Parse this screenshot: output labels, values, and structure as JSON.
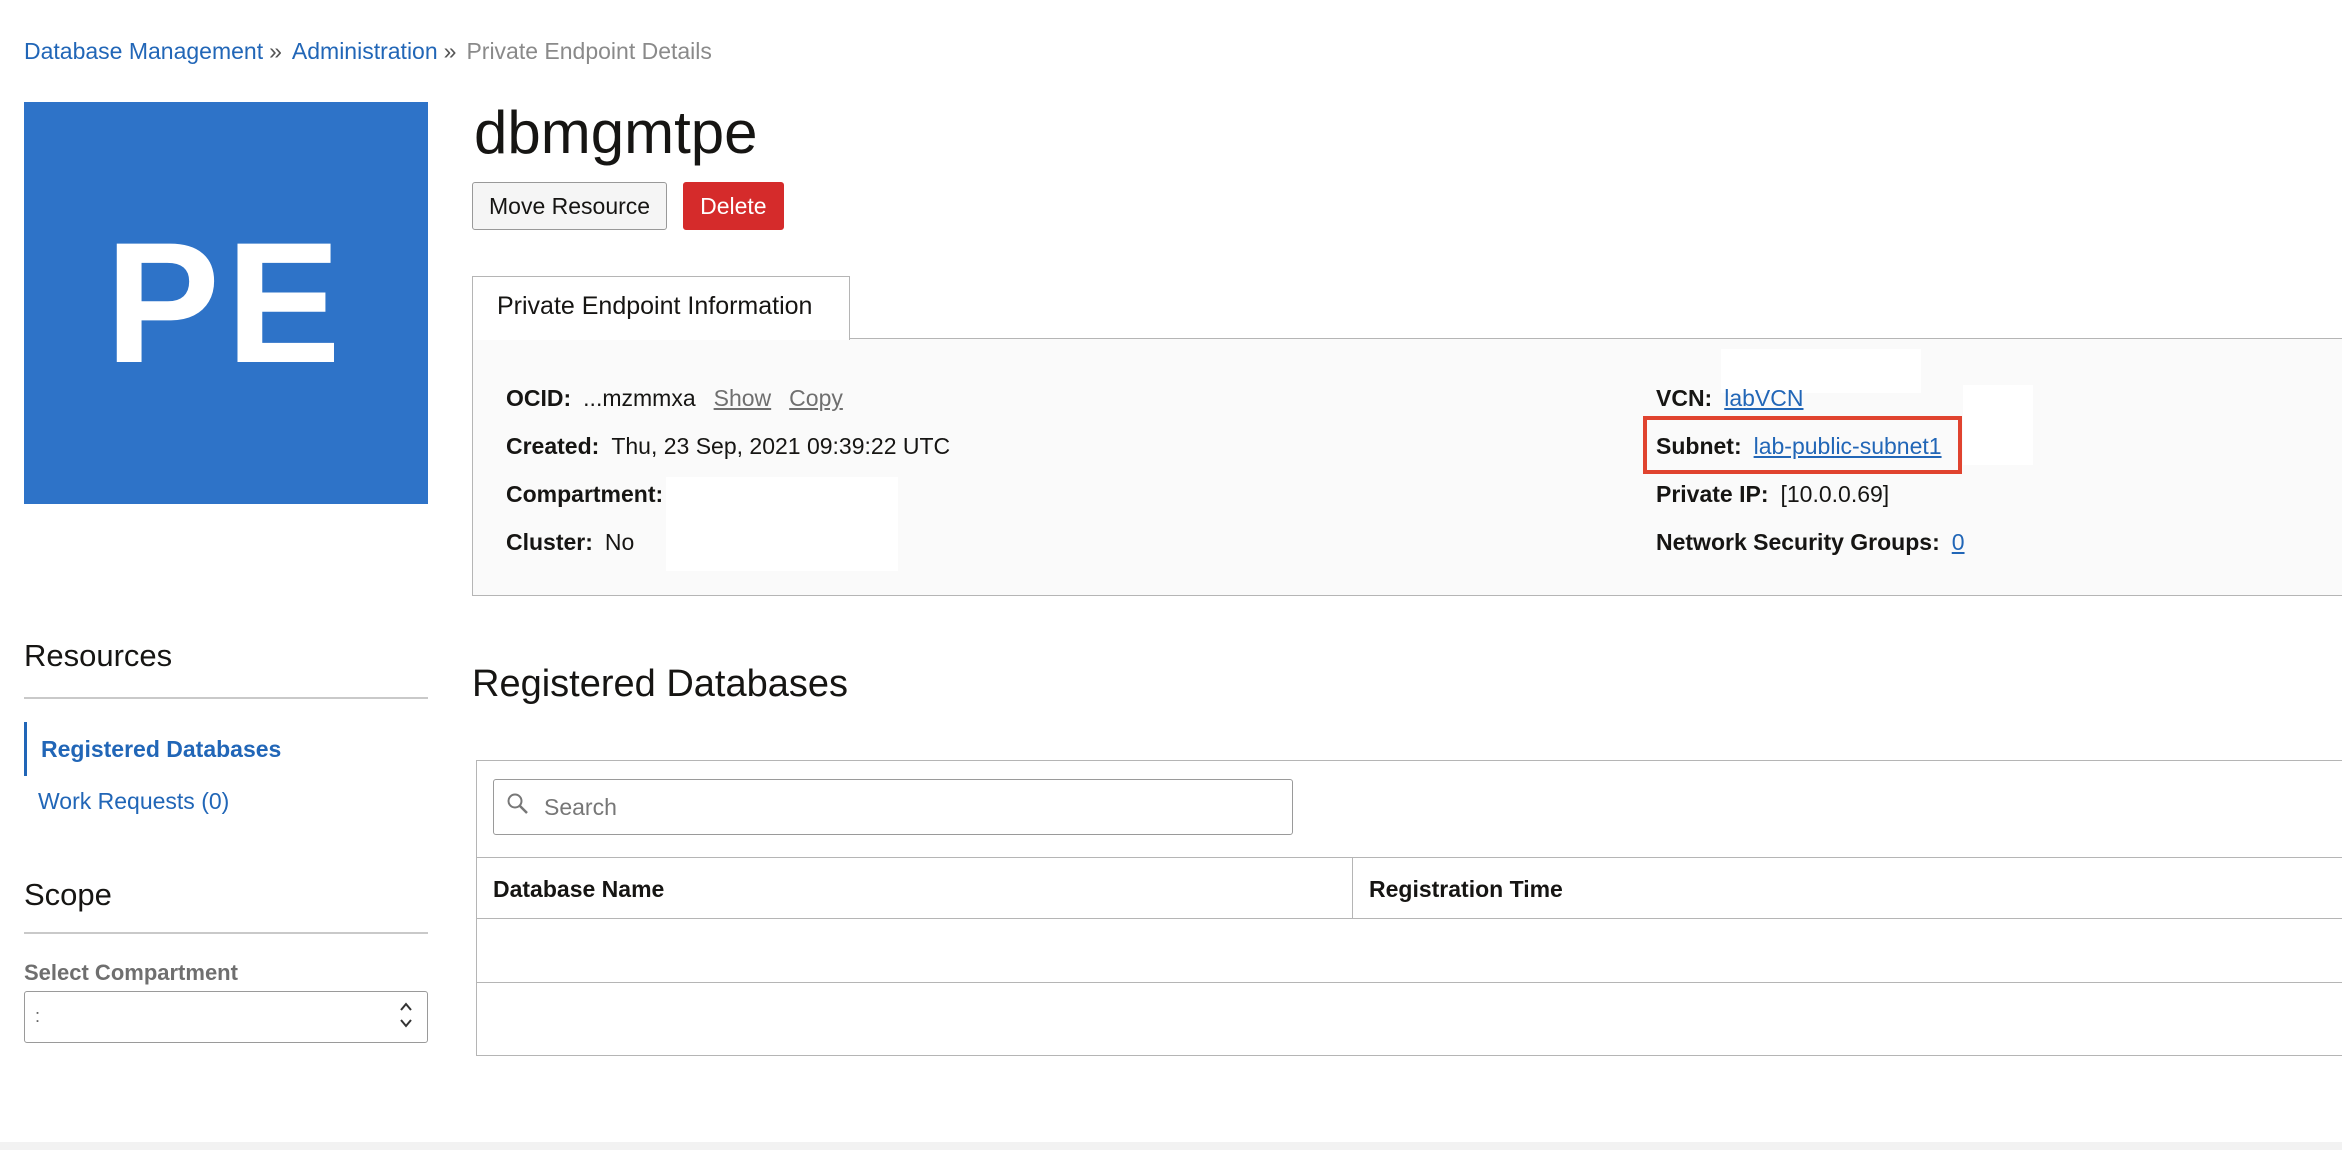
{
  "breadcrumb": [
    {
      "label": "Database Management",
      "separator": "»"
    },
    {
      "label": "Administration",
      "separator": "»"
    },
    {
      "label": "Private Endpoint Details"
    }
  ],
  "badge": {
    "text": "PE",
    "color": "#2e73c8"
  },
  "page": {
    "title": "dbmgmtpe"
  },
  "actions": {
    "move_label": "Move Resource",
    "delete_label": "Delete"
  },
  "info_tab": {
    "label": "Private Endpoint Information"
  },
  "info": {
    "ocid_label": "OCID:",
    "ocid_value": "...mzmmxa",
    "show_label": "Show",
    "copy_label": "Copy",
    "created_label": "Created:",
    "created_value": "Thu, 23 Sep, 2021 09:39:22 UTC",
    "compartment_label": "Compartment:",
    "cluster_label": "Cluster:",
    "cluster_value": "No",
    "vcn_label": "VCN:",
    "vcn_value": "labVCN",
    "subnet_label": "Subnet:",
    "subnet_value": "lab-public-subnet1",
    "private_ip_label": "Private IP:",
    "private_ip_value": "[10.0.0.69]",
    "nsg_label": "Network Security Groups:",
    "nsg_value": "0"
  },
  "sidebar": {
    "resources_title": "Resources",
    "items": [
      {
        "label": "Registered Databases",
        "active": true
      },
      {
        "label": "Work Requests (0)",
        "active": false
      }
    ],
    "scope_title": "Scope",
    "compartment_label": "Select Compartment",
    "compartment_value": ":"
  },
  "registered": {
    "title": "Registered Databases",
    "search_placeholder": "Search",
    "columns": [
      "Database Name",
      "Registration Time"
    ]
  },
  "colors": {
    "accent": "#2166b7",
    "danger": "#d52b2b",
    "highlight": "#e0432f"
  }
}
